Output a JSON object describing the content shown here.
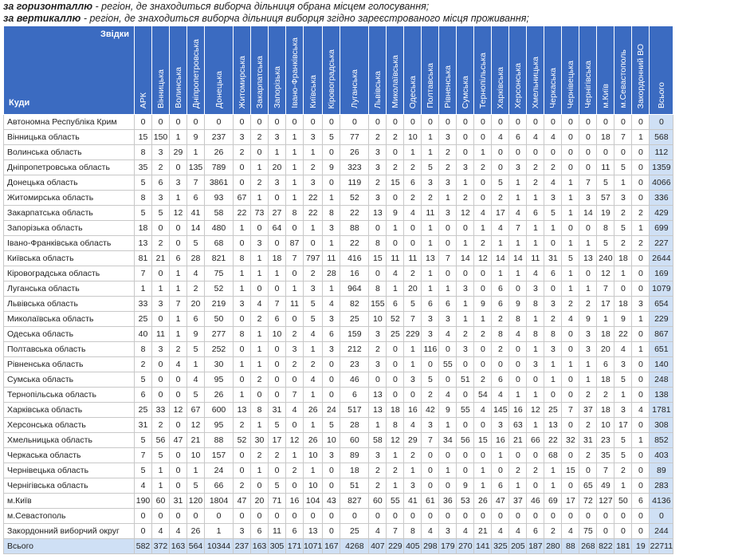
{
  "notes": {
    "line1_bold": "за горизонталлю",
    "line1_rest": " - регіон, де знаходиться виборча дільниця обрана місцем голосування;",
    "line2_bold": "за вертикаллю",
    "line2_rest": " - регіон, де знаходиться виборча дільниця виборця згідно зареєстрованого місця проживання;"
  },
  "header": {
    "from_label": "Звідки",
    "to_label": "Куди",
    "columns": [
      "АРК",
      "Вінницька",
      "Волинська",
      "Дніпропетровська",
      "Донецька",
      "Житомирська",
      "Закарпатська",
      "Запорізька",
      "Івано-Франківська",
      "Київська",
      "Кіровоградська",
      "Луганська",
      "Львівська",
      "Миколаївська",
      "Одеська",
      "Полтавська",
      "Рівненська",
      "Сумська",
      "Тернопільська",
      "Харківська",
      "Херсонська",
      "Хмельницька",
      "Черкаська",
      "Чернівецька",
      "Чернігівська",
      "м.Київ",
      "м.Севастополь",
      "Закордонний ВО",
      "Всього"
    ]
  },
  "rows": [
    {
      "name": "Автономна Республіка Крим",
      "values": [
        "0",
        "0",
        "0",
        "0",
        "0",
        "0",
        "0",
        "0",
        "0",
        "0",
        "0",
        "0",
        "0",
        "0",
        "0",
        "0",
        "0",
        "0",
        "0",
        "0",
        "0",
        "0",
        "0",
        "0",
        "0",
        "0",
        "0",
        "0",
        "0"
      ]
    },
    {
      "name": "Вінницька область",
      "values": [
        "15",
        "150",
        "1",
        "9",
        "237",
        "3",
        "2",
        "3",
        "1",
        "3",
        "5",
        "77",
        "2",
        "2",
        "10",
        "1",
        "3",
        "0",
        "0",
        "4",
        "6",
        "4",
        "4",
        "0",
        "0",
        "18",
        "7",
        "1",
        "568"
      ]
    },
    {
      "name": "Волинська область",
      "values": [
        "8",
        "3",
        "29",
        "1",
        "26",
        "2",
        "0",
        "1",
        "1",
        "1",
        "0",
        "26",
        "3",
        "0",
        "1",
        "1",
        "2",
        "0",
        "1",
        "0",
        "0",
        "0",
        "0",
        "0",
        "0",
        "0",
        "0",
        "0",
        "112"
      ]
    },
    {
      "name": "Дніпропетровська область",
      "values": [
        "35",
        "2",
        "0",
        "135",
        "789",
        "0",
        "1",
        "20",
        "1",
        "2",
        "9",
        "323",
        "3",
        "2",
        "2",
        "5",
        "2",
        "3",
        "2",
        "0",
        "3",
        "2",
        "2",
        "0",
        "0",
        "11",
        "5",
        "0",
        "1359"
      ]
    },
    {
      "name": "Донецька область",
      "values": [
        "5",
        "6",
        "3",
        "7",
        "3861",
        "0",
        "2",
        "3",
        "1",
        "3",
        "0",
        "119",
        "2",
        "15",
        "6",
        "3",
        "3",
        "1",
        "0",
        "5",
        "1",
        "2",
        "4",
        "1",
        "7",
        "5",
        "1",
        "0",
        "4066"
      ]
    },
    {
      "name": "Житомирська область",
      "values": [
        "8",
        "3",
        "1",
        "6",
        "93",
        "67",
        "1",
        "0",
        "1",
        "22",
        "1",
        "52",
        "3",
        "0",
        "2",
        "2",
        "1",
        "2",
        "0",
        "2",
        "1",
        "1",
        "3",
        "1",
        "3",
        "57",
        "3",
        "0",
        "336"
      ]
    },
    {
      "name": "Закарпатська область",
      "values": [
        "5",
        "5",
        "12",
        "41",
        "58",
        "22",
        "73",
        "27",
        "8",
        "22",
        "8",
        "22",
        "13",
        "9",
        "4",
        "11",
        "3",
        "12",
        "4",
        "17",
        "4",
        "6",
        "5",
        "1",
        "14",
        "19",
        "2",
        "2",
        "429"
      ]
    },
    {
      "name": "Запорізька область",
      "values": [
        "18",
        "0",
        "0",
        "14",
        "480",
        "1",
        "0",
        "64",
        "0",
        "1",
        "3",
        "88",
        "0",
        "1",
        "0",
        "1",
        "0",
        "0",
        "1",
        "4",
        "7",
        "1",
        "1",
        "0",
        "0",
        "8",
        "5",
        "1",
        "699"
      ]
    },
    {
      "name": "Івано-Франківська область",
      "values": [
        "13",
        "2",
        "0",
        "5",
        "68",
        "0",
        "3",
        "0",
        "87",
        "0",
        "1",
        "22",
        "8",
        "0",
        "0",
        "1",
        "0",
        "1",
        "2",
        "1",
        "1",
        "1",
        "0",
        "1",
        "1",
        "5",
        "2",
        "2",
        "227"
      ]
    },
    {
      "name": "Київська область",
      "values": [
        "81",
        "21",
        "6",
        "28",
        "821",
        "8",
        "1",
        "18",
        "7",
        "797",
        "11",
        "416",
        "15",
        "11",
        "11",
        "13",
        "7",
        "14",
        "12",
        "14",
        "14",
        "11",
        "31",
        "5",
        "13",
        "240",
        "18",
        "0",
        "2644"
      ]
    },
    {
      "name": "Кіровоградська область",
      "values": [
        "7",
        "0",
        "1",
        "4",
        "75",
        "1",
        "1",
        "1",
        "0",
        "2",
        "28",
        "16",
        "0",
        "4",
        "2",
        "1",
        "0",
        "0",
        "0",
        "1",
        "1",
        "4",
        "6",
        "1",
        "0",
        "12",
        "1",
        "0",
        "169"
      ]
    },
    {
      "name": "Луганська область",
      "values": [
        "1",
        "1",
        "1",
        "2",
        "52",
        "1",
        "0",
        "0",
        "1",
        "3",
        "1",
        "964",
        "8",
        "1",
        "20",
        "1",
        "1",
        "3",
        "0",
        "6",
        "0",
        "3",
        "0",
        "1",
        "1",
        "7",
        "0",
        "0",
        "1079"
      ]
    },
    {
      "name": "Львівська область",
      "values": [
        "33",
        "3",
        "7",
        "20",
        "219",
        "3",
        "4",
        "7",
        "11",
        "5",
        "4",
        "82",
        "155",
        "6",
        "5",
        "6",
        "6",
        "1",
        "9",
        "6",
        "9",
        "8",
        "3",
        "2",
        "2",
        "17",
        "18",
        "3",
        "654"
      ]
    },
    {
      "name": "Миколаївська область",
      "values": [
        "25",
        "0",
        "1",
        "6",
        "50",
        "0",
        "2",
        "6",
        "0",
        "5",
        "3",
        "25",
        "10",
        "52",
        "7",
        "3",
        "3",
        "1",
        "1",
        "2",
        "8",
        "1",
        "2",
        "4",
        "9",
        "1",
        "9",
        "1",
        "229"
      ]
    },
    {
      "name": "Одеська область",
      "values": [
        "40",
        "11",
        "1",
        "9",
        "277",
        "8",
        "1",
        "10",
        "2",
        "4",
        "6",
        "159",
        "3",
        "25",
        "229",
        "3",
        "4",
        "2",
        "2",
        "8",
        "4",
        "8",
        "8",
        "0",
        "3",
        "18",
        "22",
        "0",
        "867"
      ]
    },
    {
      "name": "Полтавська область",
      "values": [
        "8",
        "3",
        "2",
        "5",
        "252",
        "0",
        "1",
        "0",
        "3",
        "1",
        "3",
        "212",
        "2",
        "0",
        "1",
        "116",
        "0",
        "3",
        "0",
        "2",
        "0",
        "1",
        "3",
        "0",
        "3",
        "20",
        "4",
        "1",
        "651"
      ]
    },
    {
      "name": "Рівненська область",
      "values": [
        "2",
        "0",
        "4",
        "1",
        "30",
        "1",
        "1",
        "0",
        "2",
        "2",
        "0",
        "23",
        "3",
        "0",
        "1",
        "0",
        "55",
        "0",
        "0",
        "0",
        "0",
        "3",
        "1",
        "1",
        "1",
        "6",
        "3",
        "0",
        "140"
      ]
    },
    {
      "name": "Сумська область",
      "values": [
        "5",
        "0",
        "0",
        "4",
        "95",
        "0",
        "2",
        "0",
        "0",
        "4",
        "0",
        "46",
        "0",
        "0",
        "3",
        "5",
        "0",
        "51",
        "2",
        "6",
        "0",
        "0",
        "1",
        "0",
        "1",
        "18",
        "5",
        "0",
        "248"
      ]
    },
    {
      "name": "Тернопільська область",
      "values": [
        "6",
        "0",
        "0",
        "5",
        "26",
        "1",
        "0",
        "0",
        "7",
        "1",
        "0",
        "6",
        "13",
        "0",
        "0",
        "2",
        "4",
        "0",
        "54",
        "4",
        "1",
        "1",
        "0",
        "0",
        "2",
        "2",
        "1",
        "0",
        "138"
      ]
    },
    {
      "name": "Харківська область",
      "values": [
        "25",
        "33",
        "12",
        "67",
        "600",
        "13",
        "8",
        "31",
        "4",
        "26",
        "24",
        "517",
        "13",
        "18",
        "16",
        "42",
        "9",
        "55",
        "4",
        "145",
        "16",
        "12",
        "25",
        "7",
        "37",
        "18",
        "3",
        "4",
        "1781"
      ]
    },
    {
      "name": "Херсонська область",
      "values": [
        "31",
        "2",
        "0",
        "12",
        "95",
        "2",
        "1",
        "5",
        "0",
        "1",
        "5",
        "28",
        "1",
        "8",
        "4",
        "3",
        "1",
        "0",
        "0",
        "3",
        "63",
        "1",
        "13",
        "0",
        "2",
        "10",
        "17",
        "0",
        "308"
      ]
    },
    {
      "name": "Хмельницька область",
      "values": [
        "5",
        "56",
        "47",
        "21",
        "88",
        "52",
        "30",
        "17",
        "12",
        "26",
        "10",
        "60",
        "58",
        "12",
        "29",
        "7",
        "34",
        "56",
        "15",
        "16",
        "21",
        "66",
        "22",
        "32",
        "31",
        "23",
        "5",
        "1",
        "852"
      ]
    },
    {
      "name": "Черкаська область",
      "values": [
        "7",
        "5",
        "0",
        "10",
        "157",
        "0",
        "2",
        "2",
        "1",
        "10",
        "3",
        "89",
        "3",
        "1",
        "2",
        "0",
        "0",
        "0",
        "0",
        "1",
        "0",
        "0",
        "68",
        "0",
        "2",
        "35",
        "5",
        "0",
        "403"
      ]
    },
    {
      "name": "Чернівецька область",
      "values": [
        "5",
        "1",
        "0",
        "1",
        "24",
        "0",
        "1",
        "0",
        "2",
        "1",
        "0",
        "18",
        "2",
        "2",
        "1",
        "0",
        "1",
        "0",
        "1",
        "0",
        "2",
        "2",
        "1",
        "15",
        "0",
        "7",
        "2",
        "0",
        "89"
      ]
    },
    {
      "name": "Чернігівська область",
      "values": [
        "4",
        "1",
        "0",
        "5",
        "66",
        "2",
        "0",
        "5",
        "0",
        "10",
        "0",
        "51",
        "2",
        "1",
        "3",
        "0",
        "0",
        "9",
        "1",
        "6",
        "1",
        "0",
        "1",
        "0",
        "65",
        "49",
        "1",
        "0",
        "283"
      ]
    },
    {
      "name": "м.Київ",
      "values": [
        "190",
        "60",
        "31",
        "120",
        "1804",
        "47",
        "20",
        "71",
        "16",
        "104",
        "43",
        "827",
        "60",
        "55",
        "41",
        "61",
        "36",
        "53",
        "26",
        "47",
        "37",
        "46",
        "69",
        "17",
        "72",
        "127",
        "50",
        "6",
        "4136"
      ]
    },
    {
      "name": "м.Севастополь",
      "values": [
        "0",
        "0",
        "0",
        "0",
        "0",
        "0",
        "0",
        "0",
        "0",
        "0",
        "0",
        "0",
        "0",
        "0",
        "0",
        "0",
        "0",
        "0",
        "0",
        "0",
        "0",
        "0",
        "0",
        "0",
        "0",
        "0",
        "0",
        "0",
        "0"
      ]
    },
    {
      "name": "Закордонний виборчий округ",
      "values": [
        "0",
        "4",
        "4",
        "26",
        "1",
        "3",
        "6",
        "11",
        "6",
        "13",
        "0",
        "25",
        "4",
        "7",
        "8",
        "4",
        "3",
        "4",
        "21",
        "4",
        "4",
        "6",
        "2",
        "4",
        "75",
        "0",
        "0",
        "0",
        "244"
      ]
    }
  ],
  "total_row": {
    "name": "Всього",
    "values": [
      "582",
      "372",
      "163",
      "564",
      "10344",
      "237",
      "163",
      "305",
      "171",
      "1071",
      "167",
      "4268",
      "407",
      "229",
      "405",
      "298",
      "179",
      "270",
      "141",
      "325",
      "205",
      "187",
      "280",
      "88",
      "268",
      "822",
      "181",
      "19",
      "22711"
    ]
  }
}
